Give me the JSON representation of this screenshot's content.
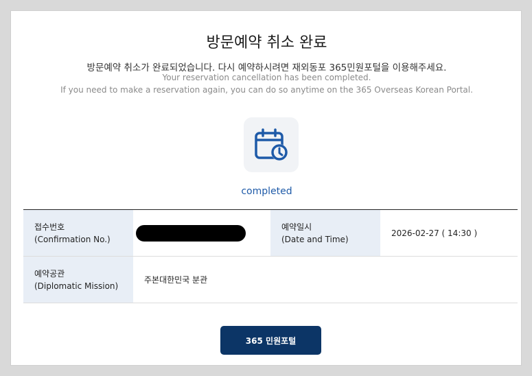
{
  "page": {
    "title": "방문예약 취소 완료",
    "message_ko": "방문예약 취소가 완료되었습니다. 다시 예약하시려면 재외동포 365민원포털을 이용해주세요.",
    "message_en_1": "Your reservation cancellation has been completed.",
    "message_en_2": "If you need to make a reservation again, you can do so anytime on the 365 Overseas Korean Portal.",
    "icon": "calendar-clock-icon",
    "status": "completed"
  },
  "details": {
    "confirmation_label_ko": "접수번호",
    "confirmation_label_en": "(Confirmation No.)",
    "confirmation_value": "",
    "datetime_label_ko": "예약일시",
    "datetime_label_en": "(Date and Time)",
    "datetime_value": "2026-02-27 ( 14:30 )",
    "mission_label_ko": "예약공관",
    "mission_label_en": "(Diplomatic Mission)",
    "mission_value": "주본대한민국 분관"
  },
  "actions": {
    "portal_button_label": "365 민원포털"
  },
  "colors": {
    "accent": "#1e5aa8",
    "button": "#0c3566",
    "header_cell": "#e8eef6"
  }
}
